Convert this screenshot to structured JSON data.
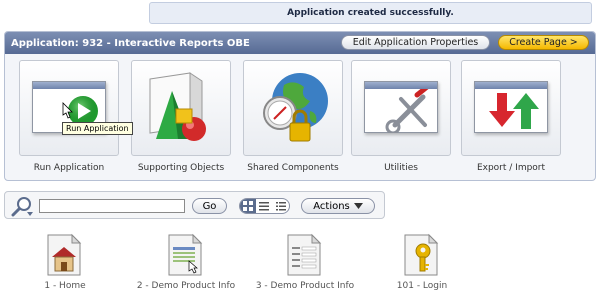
{
  "message": "Application created successfully.",
  "header": {
    "title": "Application: 932 - Interactive Reports OBE",
    "edit_button": "Edit Application Properties",
    "create_button": "Create Page >"
  },
  "tiles": [
    {
      "label": "Run Application",
      "icon": "run-application-icon"
    },
    {
      "label": "Supporting Objects",
      "icon": "supporting-objects-icon"
    },
    {
      "label": "Shared Components",
      "icon": "shared-components-icon"
    },
    {
      "label": "Utilities",
      "icon": "utilities-icon"
    },
    {
      "label": "Export / Import",
      "icon": "export-import-icon"
    }
  ],
  "tooltip": "Run Application",
  "search": {
    "value": "",
    "go_label": "Go",
    "actions_label": "Actions"
  },
  "pages": [
    {
      "label": "1 - Home",
      "icon": "home-page-icon"
    },
    {
      "label": "2 - Demo Product Info",
      "icon": "report-page-icon"
    },
    {
      "label": "3 - Demo Product Info",
      "icon": "form-page-icon"
    },
    {
      "label": "101 - Login",
      "icon": "login-page-icon"
    }
  ]
}
